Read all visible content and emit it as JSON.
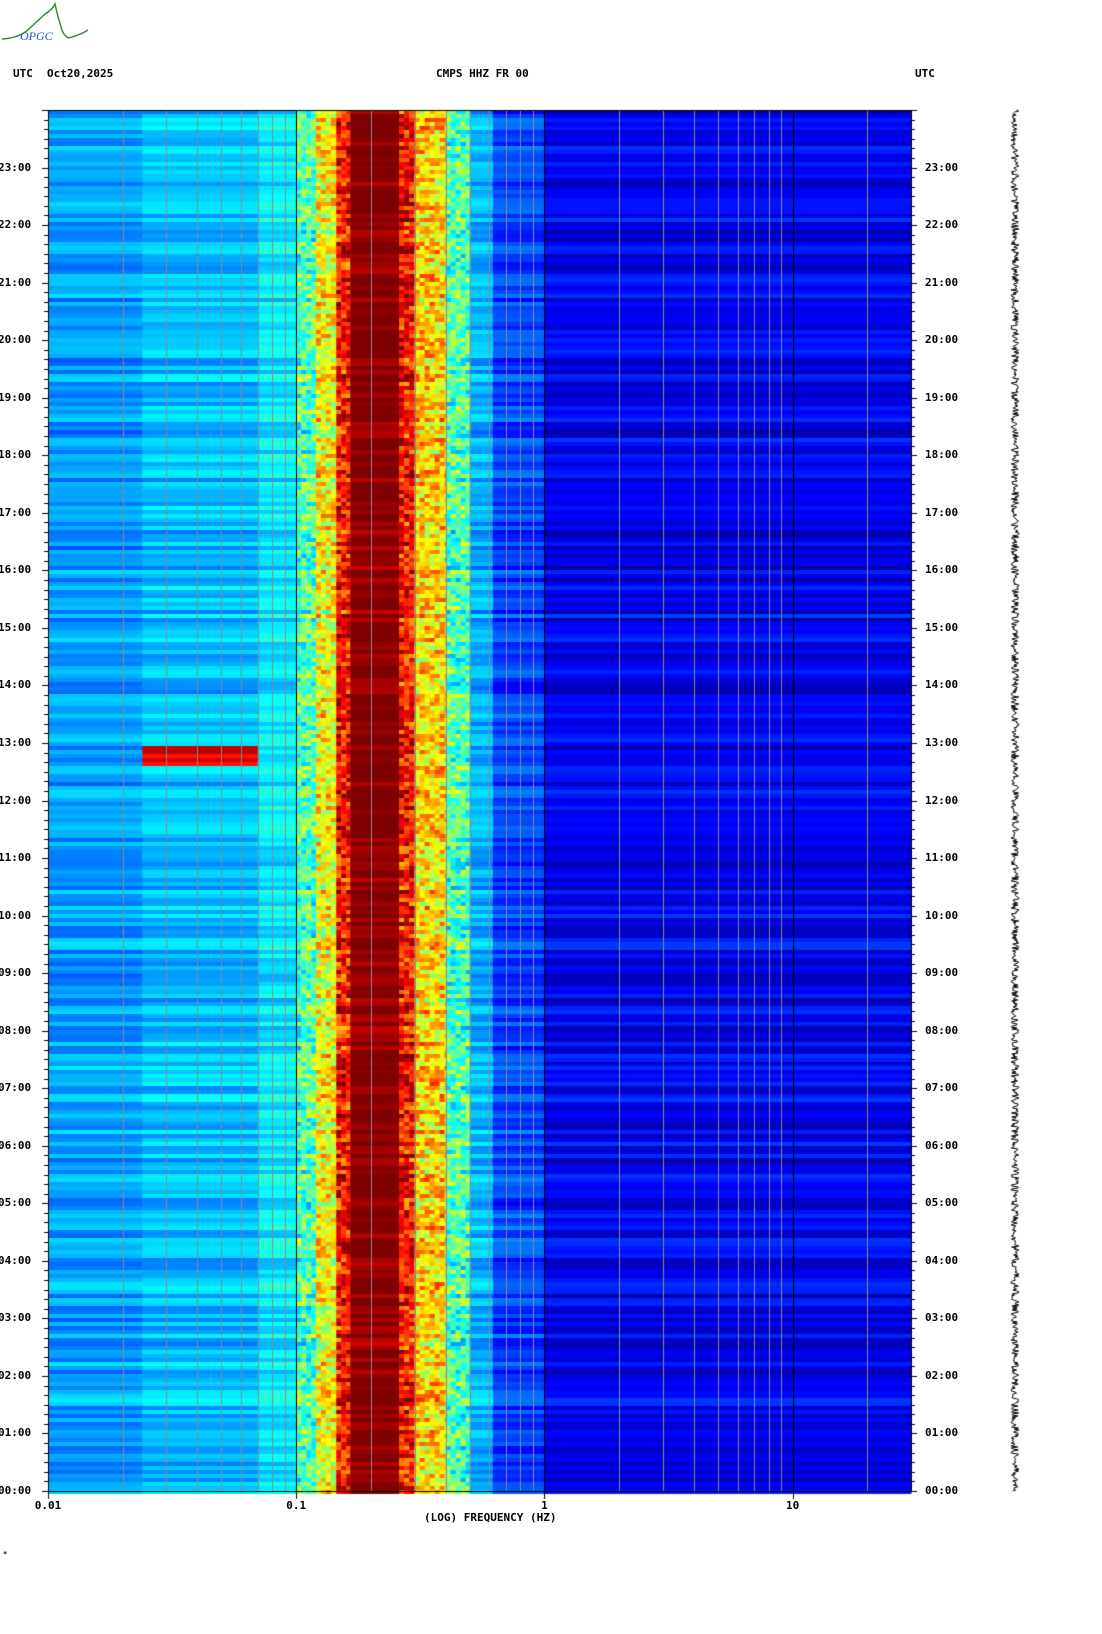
{
  "header": {
    "left_tz": "UTC",
    "date": "Oct20,2025",
    "station": "CMPS HHZ FR 00",
    "right_tz": "UTC"
  },
  "logo": {
    "text": "OPGC"
  },
  "footer_mark": "*",
  "colors": {
    "background": "#ffffff",
    "colormap": "jet"
  },
  "chart_data": {
    "type": "heatmap",
    "title": "CMPS HHZ FR 00",
    "xlabel": "(LOG) FREQUENCY (HZ)",
    "ylabel": "UTC",
    "x_scale": "log",
    "xlim": [
      0.01,
      30
    ],
    "x_ticks": [
      "0.01",
      "0.1",
      "1",
      "10"
    ],
    "x_tick_values": [
      0.01,
      0.1,
      1,
      10
    ],
    "ylim_hours": [
      0,
      24
    ],
    "y_ticks": [
      "00:00",
      "01:00",
      "02:00",
      "03:00",
      "04:00",
      "05:00",
      "06:00",
      "07:00",
      "08:00",
      "09:00",
      "10:00",
      "11:00",
      "12:00",
      "13:00",
      "14:00",
      "15:00",
      "16:00",
      "17:00",
      "18:00",
      "19:00",
      "20:00",
      "21:00",
      "22:00",
      "23:00"
    ],
    "power_profile": [
      {
        "f_min": 0.01,
        "f_max": 0.024,
        "level": 0.28
      },
      {
        "f_min": 0.024,
        "f_max": 0.07,
        "level": 0.31
      },
      {
        "f_min": 0.07,
        "f_max": 0.1,
        "level": 0.36
      },
      {
        "f_min": 0.1,
        "f_max": 0.12,
        "level": 0.45
      },
      {
        "f_min": 0.12,
        "f_max": 0.145,
        "level": 0.62
      },
      {
        "f_min": 0.145,
        "f_max": 0.165,
        "level": 0.86
      },
      {
        "f_min": 0.165,
        "f_max": 0.26,
        "level": 1.0
      },
      {
        "f_min": 0.26,
        "f_max": 0.3,
        "level": 0.86
      },
      {
        "f_min": 0.3,
        "f_max": 0.4,
        "level": 0.66
      },
      {
        "f_min": 0.4,
        "f_max": 0.5,
        "level": 0.45
      },
      {
        "f_min": 0.5,
        "f_max": 0.62,
        "level": 0.3
      },
      {
        "f_min": 0.62,
        "f_max": 1.0,
        "level": 0.19
      },
      {
        "f_min": 1.0,
        "f_max": 30,
        "level": 0.11
      }
    ],
    "events": [
      {
        "start_hour": 12.65,
        "end_hour": 12.95,
        "f_min": 0.024,
        "f_max": 0.07,
        "level": 0.9
      }
    ]
  }
}
